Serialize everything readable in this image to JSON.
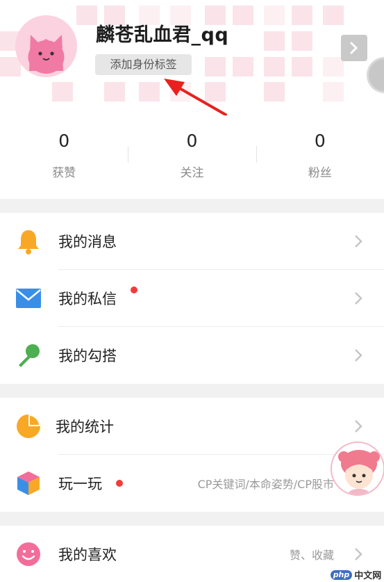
{
  "profile": {
    "username": "麟苍乱血君_qq",
    "tag_button": "添加身份标签"
  },
  "stats": [
    {
      "value": "0",
      "label": "获赞"
    },
    {
      "value": "0",
      "label": "关注"
    },
    {
      "value": "0",
      "label": "粉丝"
    }
  ],
  "menu": {
    "messages": {
      "label": "我的消息",
      "icon": "bell-icon",
      "color": "#f9a825"
    },
    "private_letters": {
      "label": "我的私信",
      "icon": "envelope-icon",
      "color": "#3a8ee6",
      "has_dot": true
    },
    "hookups": {
      "label": "我的勾搭",
      "icon": "microphone-icon",
      "color": "#4caf50"
    },
    "stats": {
      "label": "我的统计",
      "icon": "pie-chart-icon",
      "color": "#f9a825"
    },
    "play": {
      "label": "玩一玩",
      "icon": "cube-icon",
      "sub": "CP关键词/本命姿势/CP股市",
      "has_dot": true
    },
    "likes": {
      "label": "我的喜欢",
      "icon": "smiley-icon",
      "sub": "赞、收藏",
      "color": "#f36d9a"
    }
  },
  "watermark": {
    "logo": "php",
    "text": "中文网"
  },
  "colors": {
    "accent_red": "#f23b3b",
    "annotation_arrow": "#e8201e"
  }
}
